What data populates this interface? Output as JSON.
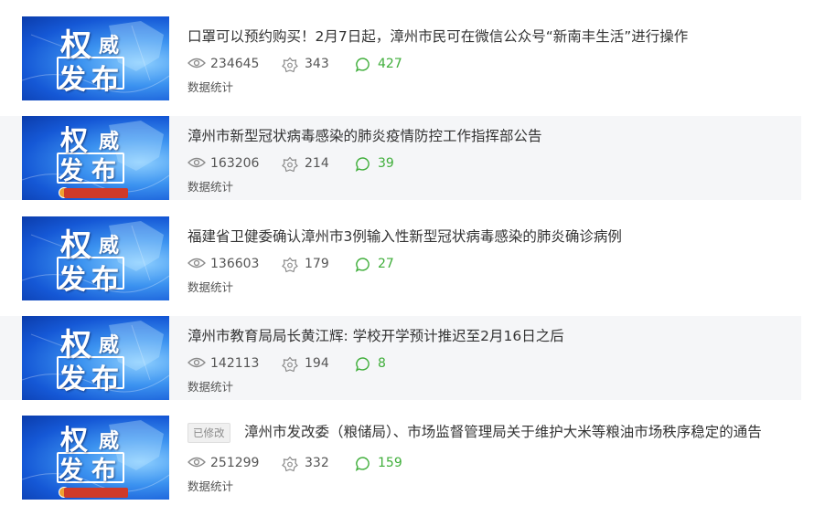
{
  "thumbnail": {
    "char_quan": "权",
    "char_wei": "威",
    "char_fa": "发",
    "char_bu": "布"
  },
  "articles": [
    {
      "title": "口罩可以预约购买！2月7日起，漳州市民可在微信公众号“新南丰生活”进行操作",
      "views": "234645",
      "likes": "343",
      "comments": "427",
      "data_link": "数据统计"
    },
    {
      "title": "漳州市新型冠状病毒感染的肺炎疫情防控工作指挥部公告",
      "views": "163206",
      "likes": "214",
      "comments": "39",
      "data_link": "数据统计"
    },
    {
      "title": "福建省卫健委确认漳州市3例输入性新型冠状病毒感染的肺炎确诊病例",
      "views": "136603",
      "likes": "179",
      "comments": "27",
      "data_link": "数据统计"
    },
    {
      "title": "漳州市教育局局长黄江辉: 学校开学预计推迟至2月16日之后",
      "views": "142113",
      "likes": "194",
      "comments": "8",
      "data_link": "数据统计"
    },
    {
      "badge": "已修改",
      "title": "漳州市发改委（粮储局）、市场监督管理局关于维护大米等粮油市场秩序稳定的通告",
      "views": "251299",
      "likes": "332",
      "comments": "159",
      "data_link": "数据统计"
    }
  ],
  "icons": {
    "views": "eye-icon",
    "likes": "flower-icon",
    "comments": "speech-bubble-icon"
  },
  "colors": {
    "comment_count": "#3fae3a",
    "row_shade": "#f5f6f8",
    "thumbnail_blue": "#1558d6",
    "station_logo": "#cf3a2a"
  }
}
